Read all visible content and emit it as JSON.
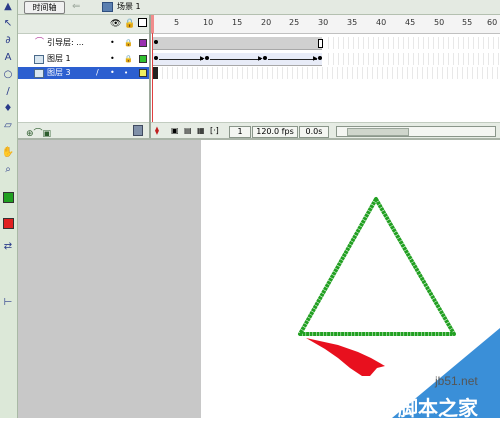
{
  "topbar": {
    "timeline_tab": "时间轴",
    "scene_label": "场景 1"
  },
  "timeline": {
    "ruler_numbers": [
      "5",
      "10",
      "15",
      "20",
      "25",
      "30",
      "35",
      "40",
      "45",
      "50",
      "55",
      "60"
    ],
    "layers": [
      {
        "name": "引导层: ...",
        "type": "guide",
        "color": "#9a2fb0"
      },
      {
        "name": "图层 1",
        "type": "normal",
        "color": "#30c030"
      },
      {
        "name": "图层 3",
        "type": "normal",
        "color": "#f0f060",
        "selected": true
      }
    ],
    "footer": {
      "current_frame": "1",
      "frame_rate": "120.0 fps",
      "elapsed": "0.0s"
    }
  },
  "stage": {
    "triangle_color": "#22a022",
    "arrow_color": "#e8101e"
  },
  "watermark": {
    "line1": "jb51.net",
    "line2": "脚本之家"
  }
}
